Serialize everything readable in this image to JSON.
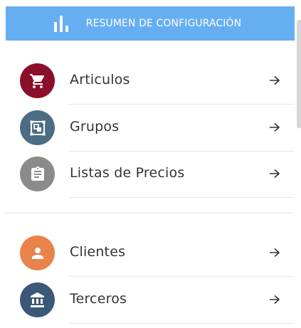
{
  "header": {
    "title": "RESUMEN DE CONFIGURACIÓN",
    "icon": "bar-chart-icon",
    "background": "#66aef2"
  },
  "items": [
    {
      "label": "Articulos",
      "icon": "shopping-cart-icon",
      "color": "#8b0f2a"
    },
    {
      "label": "Grupos",
      "icon": "group-select-icon",
      "color": "#4b6d83"
    },
    {
      "label": "Listas de Precios",
      "icon": "clipboard-list-icon",
      "color": "#8b8b8b"
    },
    {
      "label": "Clientes",
      "icon": "person-icon",
      "color": "#e8834a"
    },
    {
      "label": "Terceros",
      "icon": "bank-building-icon",
      "color": "#3b5878"
    }
  ],
  "arrow_icon": "arrow-right-icon"
}
